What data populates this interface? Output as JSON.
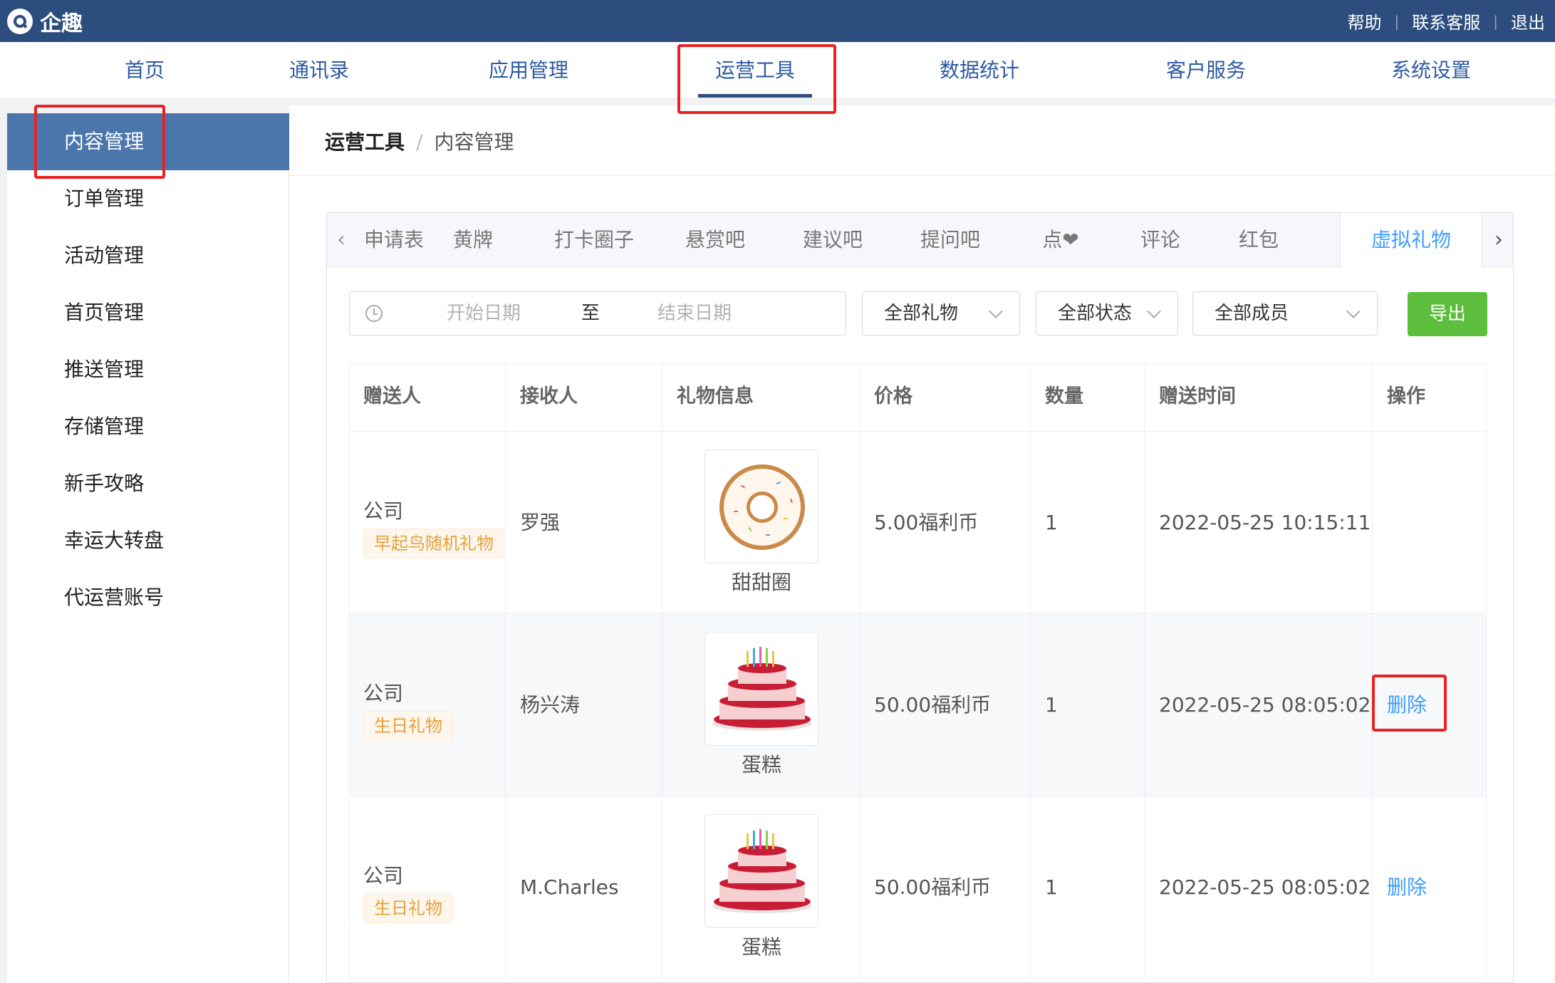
{
  "app": {
    "name": "企趣"
  },
  "top_links": {
    "help": "帮助",
    "contact": "联系客服",
    "logout": "退出",
    "sep": "|"
  },
  "nav": [
    "首页",
    "通讯录",
    "应用管理",
    "运营工具",
    "数据统计",
    "客户服务",
    "系统设置"
  ],
  "sidebar": [
    "内容管理",
    "订单管理",
    "活动管理",
    "首页管理",
    "推送管理",
    "存储管理",
    "新手攻略",
    "幸运大转盘",
    "代运营账号"
  ],
  "breadcrumb": {
    "root": "运营工具",
    "sep": "/",
    "current": "内容管理"
  },
  "tabs": [
    "申请表彰",
    "黄牌",
    "打卡圈子",
    "悬赏吧",
    "建议吧",
    "提问吧",
    "点❤",
    "评论",
    "红包",
    "虚拟礼物"
  ],
  "filters": {
    "start_placeholder": "开始日期",
    "to": "至",
    "end_placeholder": "结束日期",
    "gift_select": "全部礼物",
    "status_select": "全部状态",
    "member_select": "全部成员",
    "export": "导出"
  },
  "table": {
    "headers": [
      "赠送人",
      "接收人",
      "礼物信息",
      "价格",
      "数量",
      "赠送时间",
      "操作"
    ],
    "rows": [
      {
        "sender": "公司",
        "tag": "早起鸟随机礼物",
        "receiver": "罗强",
        "gift": "甜甜圈",
        "gift_icon": "donut-icon",
        "price": "5.00福利币",
        "qty": "1",
        "time": "2022-05-25 10:15:11",
        "action": ""
      },
      {
        "sender": "公司",
        "tag": "生日礼物",
        "receiver": "杨兴涛",
        "gift": "蛋糕",
        "gift_icon": "cake-icon",
        "price": "50.00福利币",
        "qty": "1",
        "time": "2022-05-25 08:05:02",
        "action": "删除"
      },
      {
        "sender": "公司",
        "tag": "生日礼物",
        "receiver": "M.Charles",
        "gift": "蛋糕",
        "gift_icon": "cake-icon",
        "price": "50.00福利币",
        "qty": "1",
        "time": "2022-05-25 08:05:02",
        "action": "删除"
      }
    ]
  },
  "colors": {
    "topbar": "#2c4d7d",
    "active_side": "#4a76ac",
    "link": "#409eff",
    "export": "#5cbe3c",
    "highlight": "#e82222"
  }
}
